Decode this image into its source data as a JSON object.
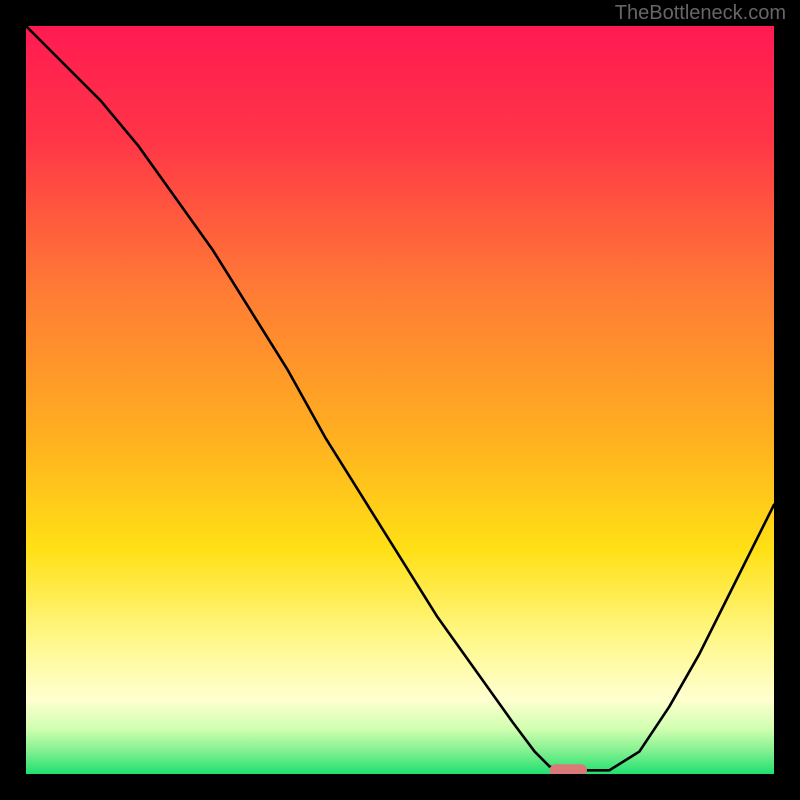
{
  "watermark": "TheBottleneck.com",
  "chart_data": {
    "type": "line",
    "title": "",
    "xlabel": "",
    "ylabel": "",
    "xlim": [
      0,
      100
    ],
    "ylim": [
      0,
      100
    ],
    "gradient_stops": [
      {
        "pos": 0.0,
        "color": "#ff1a52"
      },
      {
        "pos": 0.15,
        "color": "#ff3547"
      },
      {
        "pos": 0.35,
        "color": "#ff7a35"
      },
      {
        "pos": 0.55,
        "color": "#ffb020"
      },
      {
        "pos": 0.7,
        "color": "#ffe015"
      },
      {
        "pos": 0.82,
        "color": "#fff88a"
      },
      {
        "pos": 0.9,
        "color": "#ffffd0"
      },
      {
        "pos": 0.94,
        "color": "#d0ffb0"
      },
      {
        "pos": 0.97,
        "color": "#80f090"
      },
      {
        "pos": 1.0,
        "color": "#20e070"
      }
    ],
    "series": [
      {
        "name": "bottleneck-curve",
        "x": [
          0,
          5,
          10,
          15,
          20,
          25,
          30,
          35,
          40,
          45,
          50,
          55,
          60,
          65,
          68,
          70,
          73,
          75,
          78,
          82,
          86,
          90,
          94,
          97,
          100
        ],
        "y": [
          100,
          95,
          90,
          84,
          77,
          70,
          62,
          54,
          45,
          37,
          29,
          21,
          14,
          7,
          3,
          1,
          0.5,
          0.5,
          0.5,
          3,
          9,
          16,
          24,
          30,
          36
        ]
      }
    ],
    "marker": {
      "x_start": 70,
      "x_end": 75,
      "y": 0.5,
      "color": "#d97a78"
    }
  }
}
